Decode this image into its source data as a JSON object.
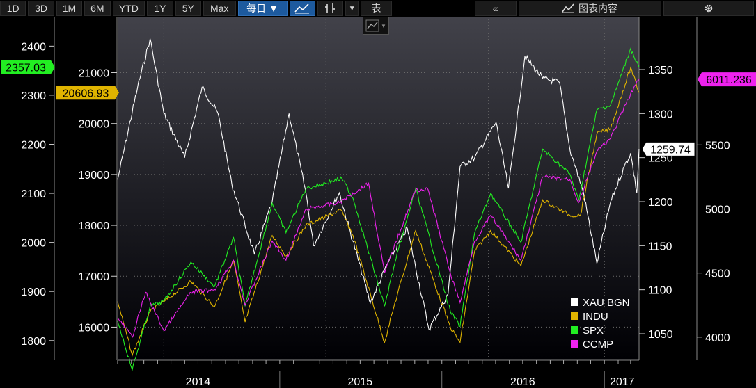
{
  "toolbar": {
    "ranges": [
      "1D",
      "3D",
      "1M",
      "6M",
      "YTD",
      "1Y",
      "5Y",
      "Max"
    ],
    "frequency": "每日 ▼",
    "table_label": "表",
    "back_label": "«",
    "panel_label": "图表内容"
  },
  "colors": {
    "XAU BGN": "#ffffff",
    "INDU": "#e0b400",
    "SPX": "#22ee22",
    "CCMP": "#ee22ee"
  },
  "chart_data": {
    "type": "line",
    "x_ticks": [
      "2014",
      "2015",
      "2016",
      "2017"
    ],
    "x_range": [
      "2014-01-01",
      "2017-03-20"
    ],
    "axes": {
      "SPX": {
        "ticks": [
          1800,
          1900,
          2000,
          2100,
          2200,
          2300,
          2400
        ],
        "range": [
          1760,
          2460
        ]
      },
      "INDU": {
        "ticks": [
          16000,
          17000,
          18000,
          19000,
          20000,
          21000
        ],
        "range": [
          15350,
          22100
        ]
      },
      "XAU BGN": {
        "ticks": [
          1050,
          1100,
          1150,
          1200,
          1250,
          1300,
          1350
        ],
        "range": [
          1020,
          1410
        ]
      },
      "CCMP": {
        "ticks": [
          4000,
          4500,
          5000,
          5500
        ],
        "range": [
          3820,
          6500
        ]
      }
    },
    "last_values": {
      "SPX": "2357.03",
      "INDU": "20606.93",
      "XAU BGN": "1259.74",
      "CCMP": "6011.236"
    },
    "series": [
      {
        "name": "XAU BGN",
        "x": [
          "2014-01-01",
          "2014-02-15",
          "2014-03-15",
          "2014-04-15",
          "2014-06-01",
          "2014-07-10",
          "2014-08-15",
          "2014-09-15",
          "2014-11-05",
          "2014-12-15",
          "2015-01-22",
          "2015-03-01",
          "2015-03-18",
          "2015-05-15",
          "2015-07-24",
          "2015-09-01",
          "2015-10-15",
          "2015-12-03",
          "2016-01-15",
          "2016-02-11",
          "2016-03-15",
          "2016-05-02",
          "2016-05-30",
          "2016-07-06",
          "2016-08-15",
          "2016-09-22",
          "2016-10-15",
          "2016-11-15",
          "2016-12-15",
          "2017-01-15",
          "2017-02-15",
          "2017-03-01",
          "2017-03-15",
          "2017-03-20"
        ],
        "values": [
          1225,
          1330,
          1385,
          1300,
          1250,
          1330,
          1300,
          1220,
          1140,
          1200,
          1300,
          1210,
          1150,
          1210,
          1085,
          1130,
          1170,
          1055,
          1095,
          1240,
          1250,
          1290,
          1215,
          1365,
          1340,
          1335,
          1260,
          1210,
          1130,
          1200,
          1240,
          1255,
          1210,
          1259.74
        ]
      },
      {
        "name": "INDU",
        "x": [
          "2014-01-01",
          "2014-02-03",
          "2014-03-15",
          "2014-04-15",
          "2014-06-15",
          "2014-08-07",
          "2014-09-19",
          "2014-10-15",
          "2014-12-15",
          "2015-01-15",
          "2015-03-01",
          "2015-05-19",
          "2015-06-15",
          "2015-08-25",
          "2015-09-15",
          "2015-11-03",
          "2016-01-20",
          "2016-02-11",
          "2016-03-15",
          "2016-04-20",
          "2016-06-27",
          "2016-08-15",
          "2016-10-15",
          "2016-11-08",
          "2016-12-15",
          "2017-01-15",
          "2017-03-01",
          "2017-03-20"
        ],
        "values": [
          16500,
          15450,
          16300,
          16500,
          16900,
          16400,
          17300,
          16100,
          17800,
          17400,
          18000,
          18300,
          17800,
          15700,
          16400,
          17900,
          16000,
          15700,
          17500,
          17900,
          17200,
          18500,
          18200,
          18200,
          19800,
          19900,
          21100,
          20606.93
        ]
      },
      {
        "name": "SPX",
        "x": [
          "2014-01-01",
          "2014-02-03",
          "2014-03-15",
          "2014-04-15",
          "2014-06-15",
          "2014-08-07",
          "2014-09-19",
          "2014-10-15",
          "2014-12-15",
          "2015-01-15",
          "2015-03-01",
          "2015-05-21",
          "2015-06-15",
          "2015-08-25",
          "2015-09-15",
          "2015-11-03",
          "2016-01-20",
          "2016-02-11",
          "2016-03-15",
          "2016-04-20",
          "2016-06-27",
          "2016-08-15",
          "2016-10-15",
          "2016-11-04",
          "2016-12-15",
          "2017-01-15",
          "2017-03-01",
          "2017-03-20"
        ],
        "values": [
          1840,
          1741,
          1870,
          1880,
          1960,
          1910,
          2010,
          1870,
          2080,
          2020,
          2110,
          2130,
          2090,
          1870,
          1950,
          2110,
          1860,
          1829,
          2020,
          2100,
          2000,
          2190,
          2140,
          2085,
          2270,
          2280,
          2395,
          2357.03
        ]
      },
      {
        "name": "CCMP",
        "x": [
          "2014-01-01",
          "2014-02-03",
          "2014-03-05",
          "2014-04-15",
          "2014-06-15",
          "2014-08-07",
          "2014-09-19",
          "2014-10-15",
          "2014-12-15",
          "2015-01-15",
          "2015-03-02",
          "2015-05-15",
          "2015-07-20",
          "2015-08-25",
          "2015-09-15",
          "2015-11-03",
          "2015-12-01",
          "2016-01-20",
          "2016-02-11",
          "2016-03-15",
          "2016-04-20",
          "2016-06-27",
          "2016-08-15",
          "2016-10-15",
          "2016-11-04",
          "2016-12-15",
          "2017-01-15",
          "2017-03-01",
          "2017-03-20"
        ],
        "values": [
          4150,
          4000,
          4350,
          4050,
          4350,
          4370,
          4600,
          4250,
          4750,
          4600,
          5000,
          5050,
          5200,
          4500,
          4700,
          5150,
          5150,
          4500,
          4270,
          4750,
          4950,
          4600,
          5250,
          5230,
          5050,
          5450,
          5550,
          5900,
          6011.236
        ]
      }
    ],
    "legend": [
      "XAU BGN",
      "INDU",
      "SPX",
      "CCMP"
    ],
    "legend_position": "bottom-right"
  }
}
